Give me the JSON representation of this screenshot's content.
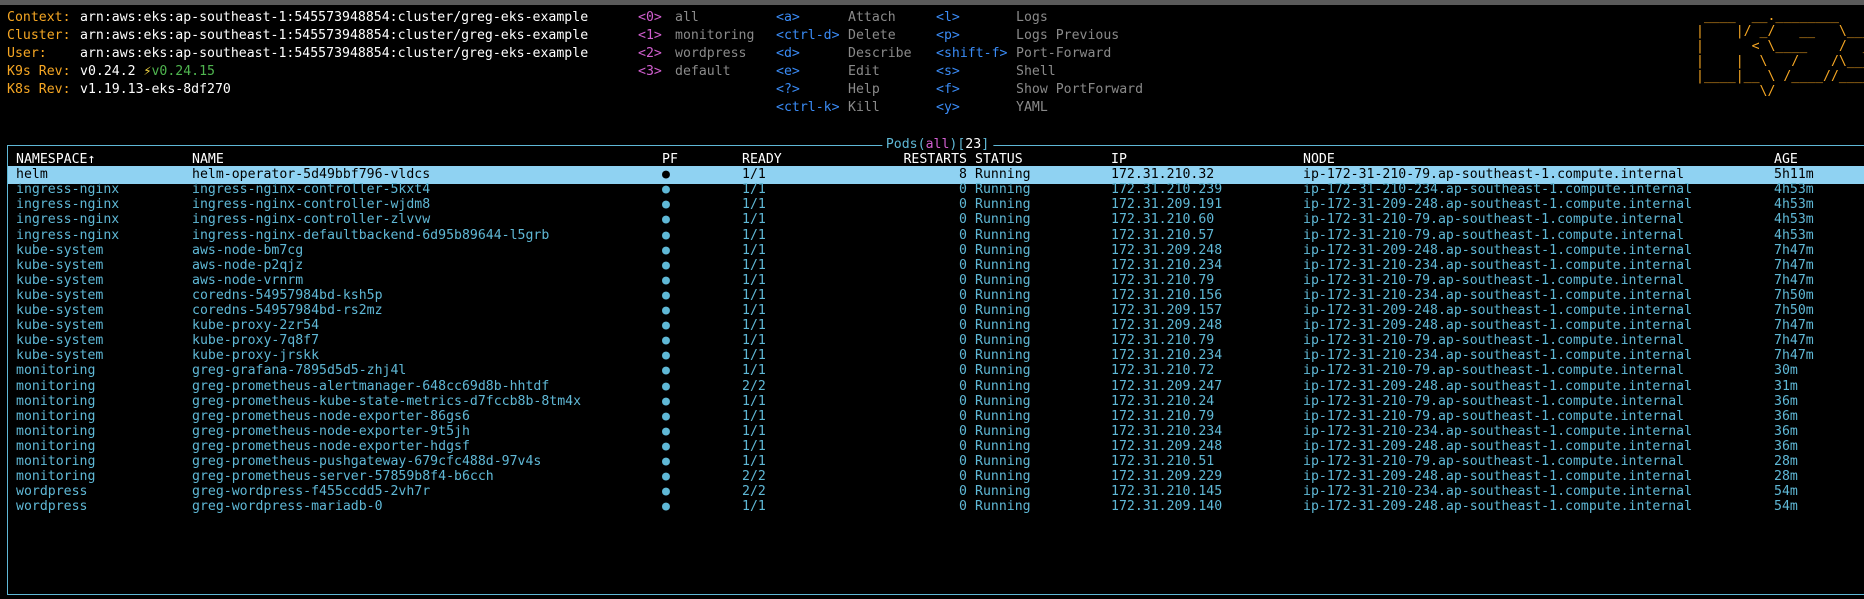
{
  "info": [
    {
      "label": "Context:",
      "value": "arn:aws:eks:ap-southeast-1:545573948854:cluster/greg-eks-example"
    },
    {
      "label": "Cluster:",
      "value": "arn:aws:eks:ap-southeast-1:545573948854:cluster/greg-eks-example"
    },
    {
      "label": "User:",
      "value": "arn:aws:eks:ap-southeast-1:545573948854:cluster/greg-eks-example"
    },
    {
      "label": "K9s Rev:",
      "value": "v0.24.2",
      "bolt": "⚡",
      "upgrade": "v0.24.15"
    },
    {
      "label": "K8s Rev:",
      "value": "v1.19.13-eks-8df270"
    }
  ],
  "namespaces": [
    {
      "key": "<0>",
      "name": "all"
    },
    {
      "key": "<1>",
      "name": "monitoring"
    },
    {
      "key": "<2>",
      "name": "wordpress"
    },
    {
      "key": "<3>",
      "name": "default"
    }
  ],
  "commands_col1": [
    {
      "key": "<a>",
      "name": "Attach"
    },
    {
      "key": "<ctrl-d>",
      "name": "Delete"
    },
    {
      "key": "<d>",
      "name": "Describe"
    },
    {
      "key": "<e>",
      "name": "Edit"
    },
    {
      "key": "<?>",
      "name": "Help"
    },
    {
      "key": "<ctrl-k>",
      "name": "Kill"
    }
  ],
  "commands_col2": [
    {
      "key": "<l>",
      "name": "Logs"
    },
    {
      "key": "<p>",
      "name": "Logs Previous"
    },
    {
      "key": "<shift-f>",
      "name": "Port-Forward"
    },
    {
      "key": "<s>",
      "name": "Shell"
    },
    {
      "key": "<f>",
      "name": "Show PortForward"
    },
    {
      "key": "<y>",
      "name": "YAML"
    }
  ],
  "logo_lines": [
    " ____  __.________      ",
    "|    |/ _/   __   \\_____",
    "|      < \\____    /  ___/",
    "|    |  \\   /    /\\___ \\",
    "|____|__ \\ /____//____  >",
    "        \\/            \\/ "
  ],
  "table": {
    "title_resource": "Pods",
    "title_filter": "all",
    "title_count": "23",
    "headers": {
      "namespace": "NAMESPACE↑",
      "name": "NAME",
      "pf": "PF",
      "ready": "READY",
      "restarts": "RESTARTS",
      "status": "STATUS",
      "ip": "IP",
      "node": "NODE",
      "age": "AGE"
    },
    "rows": [
      {
        "namespace": "helm",
        "name": "helm-operator-5d49bbf796-vldcs",
        "pf": "●",
        "ready": "1/1",
        "restarts": "8",
        "status": "Running",
        "ip": "172.31.210.32",
        "node": "ip-172-31-210-79.ap-southeast-1.compute.internal",
        "age": "5h11m"
      },
      {
        "namespace": "ingress-nginx",
        "name": "ingress-nginx-controller-5kxt4",
        "pf": "●",
        "ready": "1/1",
        "restarts": "0",
        "status": "Running",
        "ip": "172.31.210.239",
        "node": "ip-172-31-210-234.ap-southeast-1.compute.internal",
        "age": "4h53m"
      },
      {
        "namespace": "ingress-nginx",
        "name": "ingress-nginx-controller-wjdm8",
        "pf": "●",
        "ready": "1/1",
        "restarts": "0",
        "status": "Running",
        "ip": "172.31.209.191",
        "node": "ip-172-31-209-248.ap-southeast-1.compute.internal",
        "age": "4h53m"
      },
      {
        "namespace": "ingress-nginx",
        "name": "ingress-nginx-controller-zlvvw",
        "pf": "●",
        "ready": "1/1",
        "restarts": "0",
        "status": "Running",
        "ip": "172.31.210.60",
        "node": "ip-172-31-210-79.ap-southeast-1.compute.internal",
        "age": "4h53m"
      },
      {
        "namespace": "ingress-nginx",
        "name": "ingress-nginx-defaultbackend-6d95b89644-l5grb",
        "pf": "●",
        "ready": "1/1",
        "restarts": "0",
        "status": "Running",
        "ip": "172.31.210.57",
        "node": "ip-172-31-210-79.ap-southeast-1.compute.internal",
        "age": "4h53m"
      },
      {
        "namespace": "kube-system",
        "name": "aws-node-bm7cg",
        "pf": "●",
        "ready": "1/1",
        "restarts": "0",
        "status": "Running",
        "ip": "172.31.209.248",
        "node": "ip-172-31-209-248.ap-southeast-1.compute.internal",
        "age": "7h47m"
      },
      {
        "namespace": "kube-system",
        "name": "aws-node-p2qjz",
        "pf": "●",
        "ready": "1/1",
        "restarts": "0",
        "status": "Running",
        "ip": "172.31.210.234",
        "node": "ip-172-31-210-234.ap-southeast-1.compute.internal",
        "age": "7h47m"
      },
      {
        "namespace": "kube-system",
        "name": "aws-node-vrnrm",
        "pf": "●",
        "ready": "1/1",
        "restarts": "0",
        "status": "Running",
        "ip": "172.31.210.79",
        "node": "ip-172-31-210-79.ap-southeast-1.compute.internal",
        "age": "7h47m"
      },
      {
        "namespace": "kube-system",
        "name": "coredns-54957984bd-ksh5p",
        "pf": "●",
        "ready": "1/1",
        "restarts": "0",
        "status": "Running",
        "ip": "172.31.210.156",
        "node": "ip-172-31-210-234.ap-southeast-1.compute.internal",
        "age": "7h50m"
      },
      {
        "namespace": "kube-system",
        "name": "coredns-54957984bd-rs2mz",
        "pf": "●",
        "ready": "1/1",
        "restarts": "0",
        "status": "Running",
        "ip": "172.31.209.157",
        "node": "ip-172-31-209-248.ap-southeast-1.compute.internal",
        "age": "7h50m"
      },
      {
        "namespace": "kube-system",
        "name": "kube-proxy-2zr54",
        "pf": "●",
        "ready": "1/1",
        "restarts": "0",
        "status": "Running",
        "ip": "172.31.209.248",
        "node": "ip-172-31-209-248.ap-southeast-1.compute.internal",
        "age": "7h47m"
      },
      {
        "namespace": "kube-system",
        "name": "kube-proxy-7q8f7",
        "pf": "●",
        "ready": "1/1",
        "restarts": "0",
        "status": "Running",
        "ip": "172.31.210.79",
        "node": "ip-172-31-210-79.ap-southeast-1.compute.internal",
        "age": "7h47m"
      },
      {
        "namespace": "kube-system",
        "name": "kube-proxy-jrskk",
        "pf": "●",
        "ready": "1/1",
        "restarts": "0",
        "status": "Running",
        "ip": "172.31.210.234",
        "node": "ip-172-31-210-234.ap-southeast-1.compute.internal",
        "age": "7h47m"
      },
      {
        "namespace": "monitoring",
        "name": "greg-grafana-7895d5d5-zhj4l",
        "pf": "●",
        "ready": "1/1",
        "restarts": "0",
        "status": "Running",
        "ip": "172.31.210.72",
        "node": "ip-172-31-210-79.ap-southeast-1.compute.internal",
        "age": "30m"
      },
      {
        "namespace": "monitoring",
        "name": "greg-prometheus-alertmanager-648cc69d8b-hhtdf",
        "pf": "●",
        "ready": "2/2",
        "restarts": "0",
        "status": "Running",
        "ip": "172.31.209.247",
        "node": "ip-172-31-209-248.ap-southeast-1.compute.internal",
        "age": "31m"
      },
      {
        "namespace": "monitoring",
        "name": "greg-prometheus-kube-state-metrics-d7fccb8b-8tm4x",
        "pf": "●",
        "ready": "1/1",
        "restarts": "0",
        "status": "Running",
        "ip": "172.31.210.24",
        "node": "ip-172-31-210-79.ap-southeast-1.compute.internal",
        "age": "36m"
      },
      {
        "namespace": "monitoring",
        "name": "greg-prometheus-node-exporter-86gs6",
        "pf": "●",
        "ready": "1/1",
        "restarts": "0",
        "status": "Running",
        "ip": "172.31.210.79",
        "node": "ip-172-31-210-79.ap-southeast-1.compute.internal",
        "age": "36m"
      },
      {
        "namespace": "monitoring",
        "name": "greg-prometheus-node-exporter-9t5jh",
        "pf": "●",
        "ready": "1/1",
        "restarts": "0",
        "status": "Running",
        "ip": "172.31.210.234",
        "node": "ip-172-31-210-234.ap-southeast-1.compute.internal",
        "age": "36m"
      },
      {
        "namespace": "monitoring",
        "name": "greg-prometheus-node-exporter-hdgsf",
        "pf": "●",
        "ready": "1/1",
        "restarts": "0",
        "status": "Running",
        "ip": "172.31.209.248",
        "node": "ip-172-31-209-248.ap-southeast-1.compute.internal",
        "age": "36m"
      },
      {
        "namespace": "monitoring",
        "name": "greg-prometheus-pushgateway-679cfc488d-97v4s",
        "pf": "●",
        "ready": "1/1",
        "restarts": "0",
        "status": "Running",
        "ip": "172.31.210.51",
        "node": "ip-172-31-210-79.ap-southeast-1.compute.internal",
        "age": "28m"
      },
      {
        "namespace": "monitoring",
        "name": "greg-prometheus-server-57859b8f4-b6cch",
        "pf": "●",
        "ready": "2/2",
        "restarts": "0",
        "status": "Running",
        "ip": "172.31.209.229",
        "node": "ip-172-31-209-248.ap-southeast-1.compute.internal",
        "age": "28m"
      },
      {
        "namespace": "wordpress",
        "name": "greg-wordpress-f455ccdd5-2vh7r",
        "pf": "●",
        "ready": "2/2",
        "restarts": "0",
        "status": "Running",
        "ip": "172.31.210.145",
        "node": "ip-172-31-210-234.ap-southeast-1.compute.internal",
        "age": "54m"
      },
      {
        "namespace": "wordpress",
        "name": "greg-wordpress-mariadb-0",
        "pf": "●",
        "ready": "1/1",
        "restarts": "0",
        "status": "Running",
        "ip": "172.31.209.140",
        "node": "ip-172-31-209-248.ap-southeast-1.compute.internal",
        "age": "54m"
      }
    ]
  },
  "colors": {
    "accent": "#5fb8d6",
    "label": "#f5a623",
    "namespace_key": "#d25fd0",
    "command_key": "#3a8bf5",
    "selected_row_bg": "#8fd2f2"
  }
}
